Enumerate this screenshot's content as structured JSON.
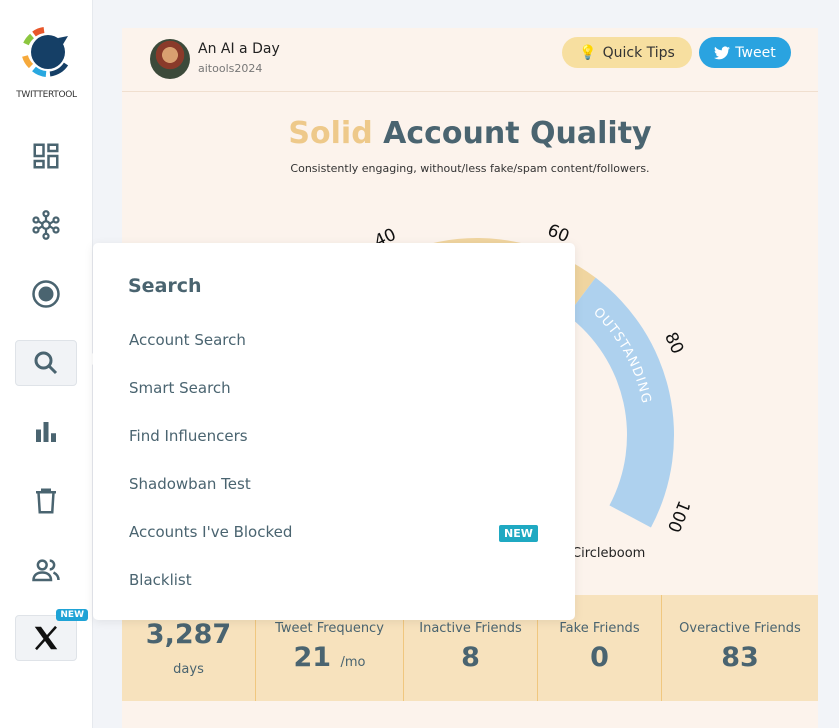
{
  "sidebar": {
    "logo_text": "TWITTERTOOL",
    "items": [
      {
        "icon": "dashboard-icon"
      },
      {
        "icon": "network-icon"
      },
      {
        "icon": "record-icon"
      },
      {
        "icon": "search-icon",
        "active": true
      },
      {
        "icon": "bar-chart-icon"
      },
      {
        "icon": "trash-icon"
      },
      {
        "icon": "users-icon"
      },
      {
        "icon": "x-logo-icon",
        "badge": "NEW"
      }
    ]
  },
  "header": {
    "name": "An AI a Day",
    "handle": "aitools2024",
    "quick_tips": "Quick Tips",
    "tweet": "Tweet"
  },
  "quality": {
    "level": "Solid",
    "title": "Account Quality",
    "subtitle": "Consistently engaging, without/less fake/spam content/followers."
  },
  "gauge": {
    "ticks": [
      "40",
      "60",
      "80",
      "100"
    ],
    "band_label": "OUTSTANDING",
    "colors": {
      "solid": "#f0d5a0",
      "outstanding": "#aed1ee"
    },
    "footer": "Circleboom"
  },
  "stats": [
    {
      "label": "",
      "value": "3,287",
      "unit": "days"
    },
    {
      "label": "Tweet Frequency",
      "value": "21",
      "unit": "/mo"
    },
    {
      "label": "Inactive Friends",
      "value": "8"
    },
    {
      "label": "Fake Friends",
      "value": "0"
    },
    {
      "label": "Overactive Friends",
      "value": "83"
    }
  ],
  "menu": {
    "title": "Search",
    "items": [
      "Account Search",
      "Smart Search",
      "Find Influencers",
      "Shadowban Test",
      "Accounts I've Blocked",
      "Blacklist"
    ],
    "new_badge": "NEW"
  }
}
